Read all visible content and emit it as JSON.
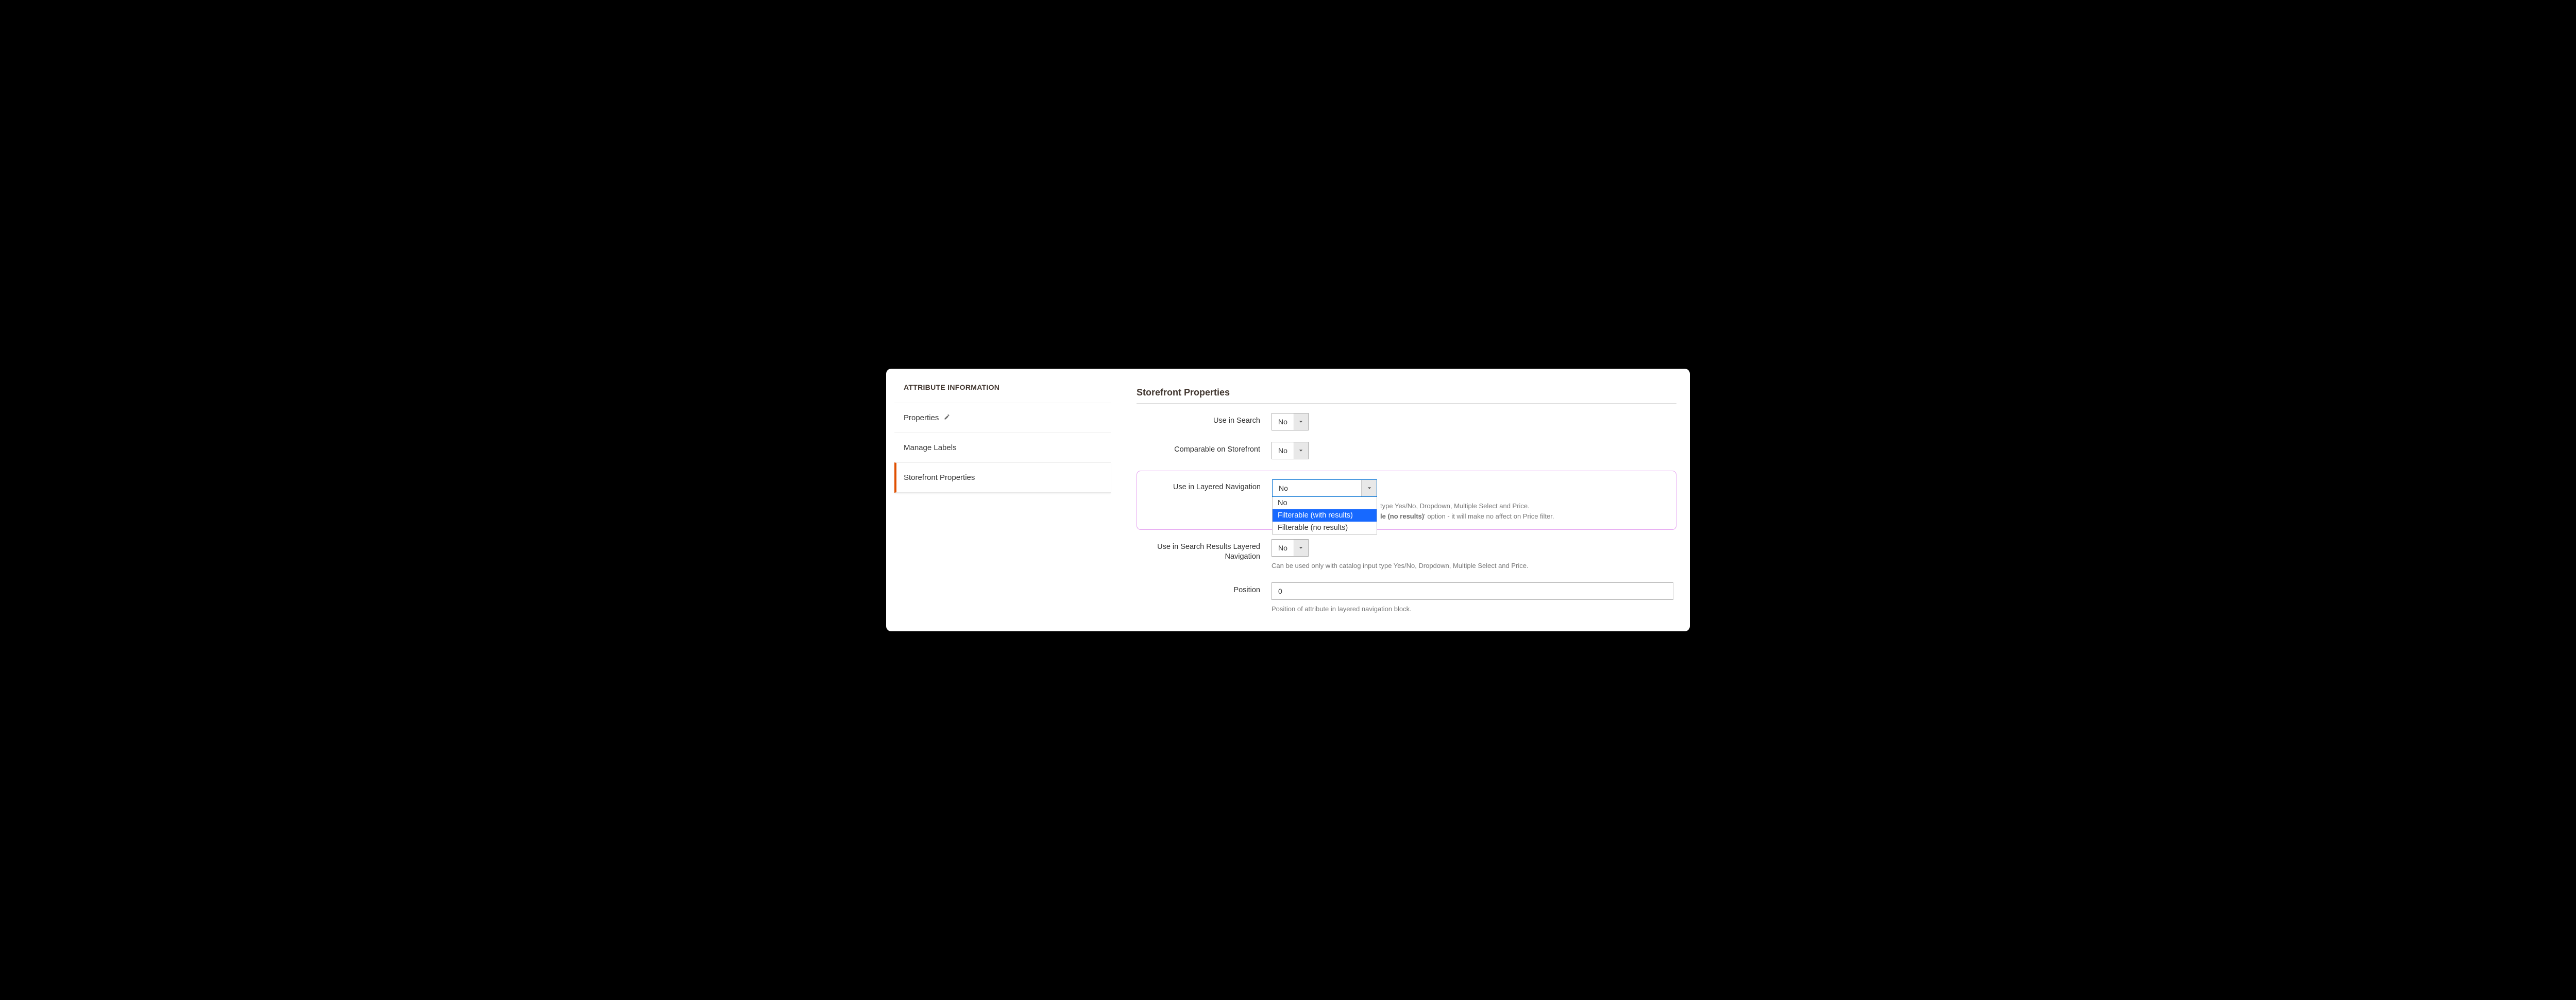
{
  "sidebar": {
    "header": "ATTRIBUTE INFORMATION",
    "items": [
      {
        "label": "Properties",
        "editable": true
      },
      {
        "label": "Manage Labels"
      },
      {
        "label": "Storefront Properties",
        "active": true
      }
    ]
  },
  "section_title": "Storefront Properties",
  "fields": {
    "use_in_search": {
      "label": "Use in Search",
      "value": "No"
    },
    "comparable": {
      "label": "Comparable on Storefront",
      "value": "No"
    },
    "layered_nav": {
      "label": "Use in Layered Navigation",
      "value": "No",
      "options": [
        "No",
        "Filterable (with results)",
        "Filterable (no results)"
      ],
      "selected_option": "Filterable (with results)",
      "help_visible_1": "type Yes/No, Dropdown, Multiple Select and Price.",
      "help_bold": "le (no results)",
      "help_visible_2": "' option - it will make no affect on Price filter."
    },
    "search_results_layered": {
      "label": "Use in Search Results Layered Navigation",
      "value": "No",
      "help": "Can be used only with catalog input type Yes/No, Dropdown, Multiple Select and Price."
    },
    "position": {
      "label": "Position",
      "value": "0",
      "help": "Position of attribute in layered navigation block."
    }
  }
}
